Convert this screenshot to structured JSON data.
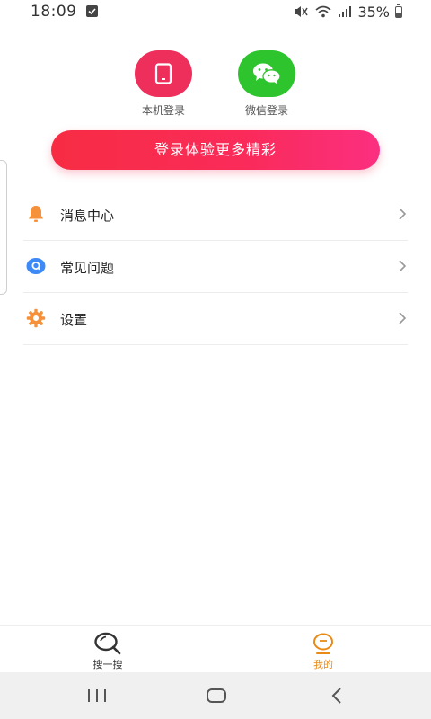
{
  "status_bar": {
    "time": "18:09",
    "battery": "35%"
  },
  "login": {
    "phone_label": "本机登录",
    "wechat_label": "微信登录",
    "cta_label": "登录体验更多精彩",
    "phone_color": "#ee2f5b",
    "wechat_color": "#2ec42e"
  },
  "menu": {
    "items": [
      {
        "label": "消息中心",
        "icon": "bell-icon"
      },
      {
        "label": "常见问题",
        "icon": "help-icon"
      },
      {
        "label": "设置",
        "icon": "gear-icon"
      }
    ]
  },
  "tab_bar": {
    "search_label": "搜一搜",
    "mine_label": "我的",
    "active_color": "#e98a17"
  }
}
